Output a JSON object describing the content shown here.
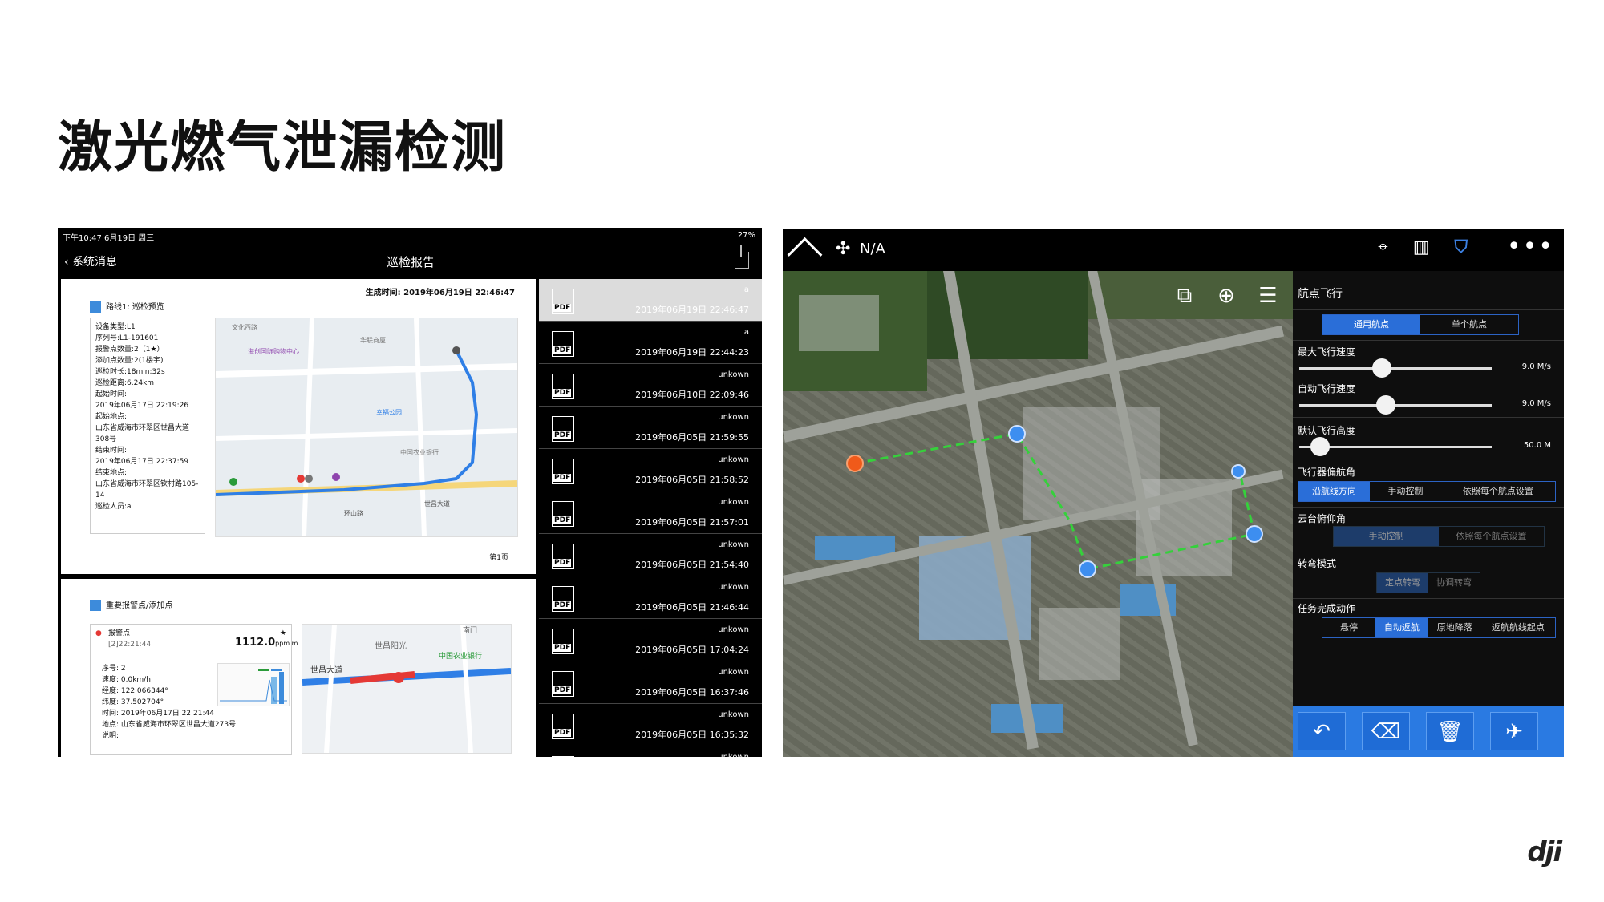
{
  "slide": {
    "title": "激光燃气泄漏检测",
    "logo": "dji"
  },
  "report_app": {
    "status_time": "下午10:47  6月19日 周三",
    "status_right": "27%",
    "back_label": "系统消息",
    "title": "巡检报告",
    "generated": "生成时间: 2019年06月19日 22:46:47",
    "route_section": "路线1: 巡检预览",
    "info": {
      "device_type": "设备类型:L1",
      "serial": "序列号:L1-191601",
      "alarm_count": "报警点数量:2（1★）",
      "added_count": "添加点数量:2(1楼宇)",
      "duration": "巡检时长:18min:32s",
      "distance": "巡检距离:6.24km",
      "start_time_label": "起始时间:",
      "start_time": "2019年06月17日 22:19:26",
      "start_place_label": "起始地点:",
      "start_place": "山东省威海市环翠区世昌大道308号",
      "end_time_label": "结束时间:",
      "end_time": "2019年06月17日 22:37:59",
      "end_place_label": "结束地点:",
      "end_place": "山东省威海市环翠区钦村路105-14",
      "inspector": "巡检人员:a"
    },
    "page_num": "第1页",
    "alarm_section": "重要报警点/添加点",
    "alarm": {
      "name": "报警点",
      "time_code": "[2]22:21:44",
      "value": "1112.0",
      "unit": "ppm.m",
      "index": "序号: 2",
      "speed": "速度: 0.0km/h",
      "lon": "经度: 122.066344°",
      "lat": "纬度: 37.502704°",
      "time": "时间: 2019年06月17日 22:21:44",
      "place": "地点: 山东省威海市环翠区世昌大道273号",
      "note": "说明:"
    },
    "map_labels": {
      "a1": "文化西路",
      "a2": "海创国际购物中心",
      "a3": "华联商厦",
      "a4": "中国农业银行",
      "a5": "世昌大道",
      "a6": "环山路",
      "a7": "幸福公园",
      "b1": "世昌阳光",
      "b2": "中国农业银行",
      "b3": "世昌大道",
      "b4": "南门"
    },
    "pdf_items": [
      {
        "name": "a",
        "date": "2019年06月19日 22:46:47",
        "selected": true
      },
      {
        "name": "a",
        "date": "2019年06月19日 22:44:23"
      },
      {
        "name": "unkown",
        "date": "2019年06月10日 22:09:46"
      },
      {
        "name": "unkown",
        "date": "2019年06月05日 21:59:55"
      },
      {
        "name": "unkown",
        "date": "2019年06月05日 21:58:52"
      },
      {
        "name": "unkown",
        "date": "2019年06月05日 21:57:01"
      },
      {
        "name": "unkown",
        "date": "2019年06月05日 21:54:40"
      },
      {
        "name": "unkown",
        "date": "2019年06月05日 21:46:44"
      },
      {
        "name": "unkown",
        "date": "2019年06月05日 17:04:24"
      },
      {
        "name": "unkown",
        "date": "2019年06月05日 16:37:46"
      },
      {
        "name": "unkown",
        "date": "2019年06月05日 16:35:32"
      },
      {
        "name": "unkown",
        "date": ""
      }
    ],
    "pdf_icon_label": "PDF"
  },
  "drone_app": {
    "drone_status": "N/A",
    "panel_title": "航点飞行",
    "mode_tabs": [
      "通用航点",
      "单个航点"
    ],
    "max_speed_label": "最大飞行速度",
    "max_speed_value": "9.0 M/s",
    "max_speed_fraction": 0.43,
    "auto_speed_label": "自动飞行速度",
    "auto_speed_value": "9.0 M/s",
    "auto_speed_fraction": 0.45,
    "altitude_label": "默认飞行高度",
    "altitude_value": "50.0 M",
    "altitude_fraction": 0.11,
    "heading_label": "飞行器偏航角",
    "heading_tabs": [
      "沿航线方向",
      "手动控制",
      "依照每个航点设置"
    ],
    "gimbal_label": "云台俯仰角",
    "gimbal_tabs": [
      "手动控制",
      "依照每个航点设置"
    ],
    "turn_label": "转弯模式",
    "turn_tabs": [
      "定点转弯",
      "协调转弯"
    ],
    "finish_label": "任务完成动作",
    "finish_tabs": [
      "悬停",
      "自动返航",
      "原地降落",
      "返航航线起点"
    ],
    "colors": {
      "accent": "#2a6ed8",
      "route": "#35d13b",
      "waypoint": "#3d8ef0",
      "start": "#f05a1a"
    }
  }
}
